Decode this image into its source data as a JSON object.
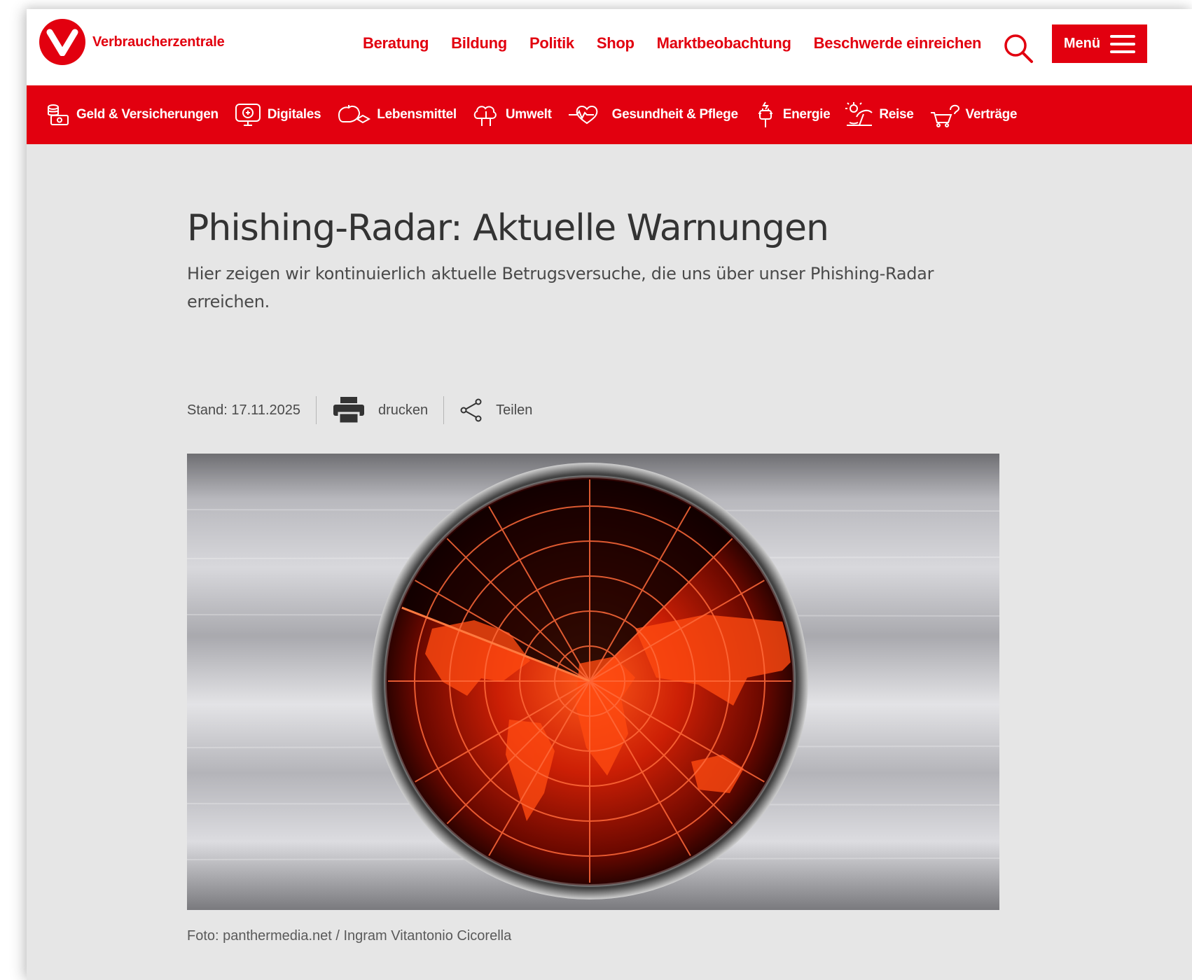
{
  "brand": {
    "name": "Verbraucherzentrale",
    "color": "#e2000f",
    "logo_icon": "v-logo-icon"
  },
  "topnav": {
    "items": [
      "Beratung",
      "Bildung",
      "Politik",
      "Shop",
      "Marktbeobachtung",
      "Beschwerde einreichen"
    ],
    "search_icon": "search-icon",
    "menu_label": "Menü",
    "menu_icon": "hamburger-icon"
  },
  "categories": [
    {
      "label": "Geld & Versicherungen",
      "icon": "money-icon"
    },
    {
      "label": "Digitales",
      "icon": "monitor-icon"
    },
    {
      "label": "Lebensmittel",
      "icon": "food-icon"
    },
    {
      "label": "Umwelt",
      "icon": "tree-icon"
    },
    {
      "label": "Gesundheit & Pflege",
      "icon": "heartbeat-icon"
    },
    {
      "label": "Energie",
      "icon": "plug-icon"
    },
    {
      "label": "Reise",
      "icon": "beach-icon"
    },
    {
      "label": "Verträge",
      "icon": "cart-icon"
    }
  ],
  "article": {
    "title": "Phishing-Radar: Aktuelle Warnungen",
    "lead": "Hier zeigen wir kontinuierlich aktuelle Betrugsversuche, die uns über unser Phishing-Radar erreichen.",
    "stand": "Stand: 17.11.2025",
    "print_label": "drucken",
    "share_label": "Teilen",
    "image_alt": "radar-world-map-image",
    "caption": "Foto: panthermedia.net / Ingram Vitantonio Cicorella"
  }
}
